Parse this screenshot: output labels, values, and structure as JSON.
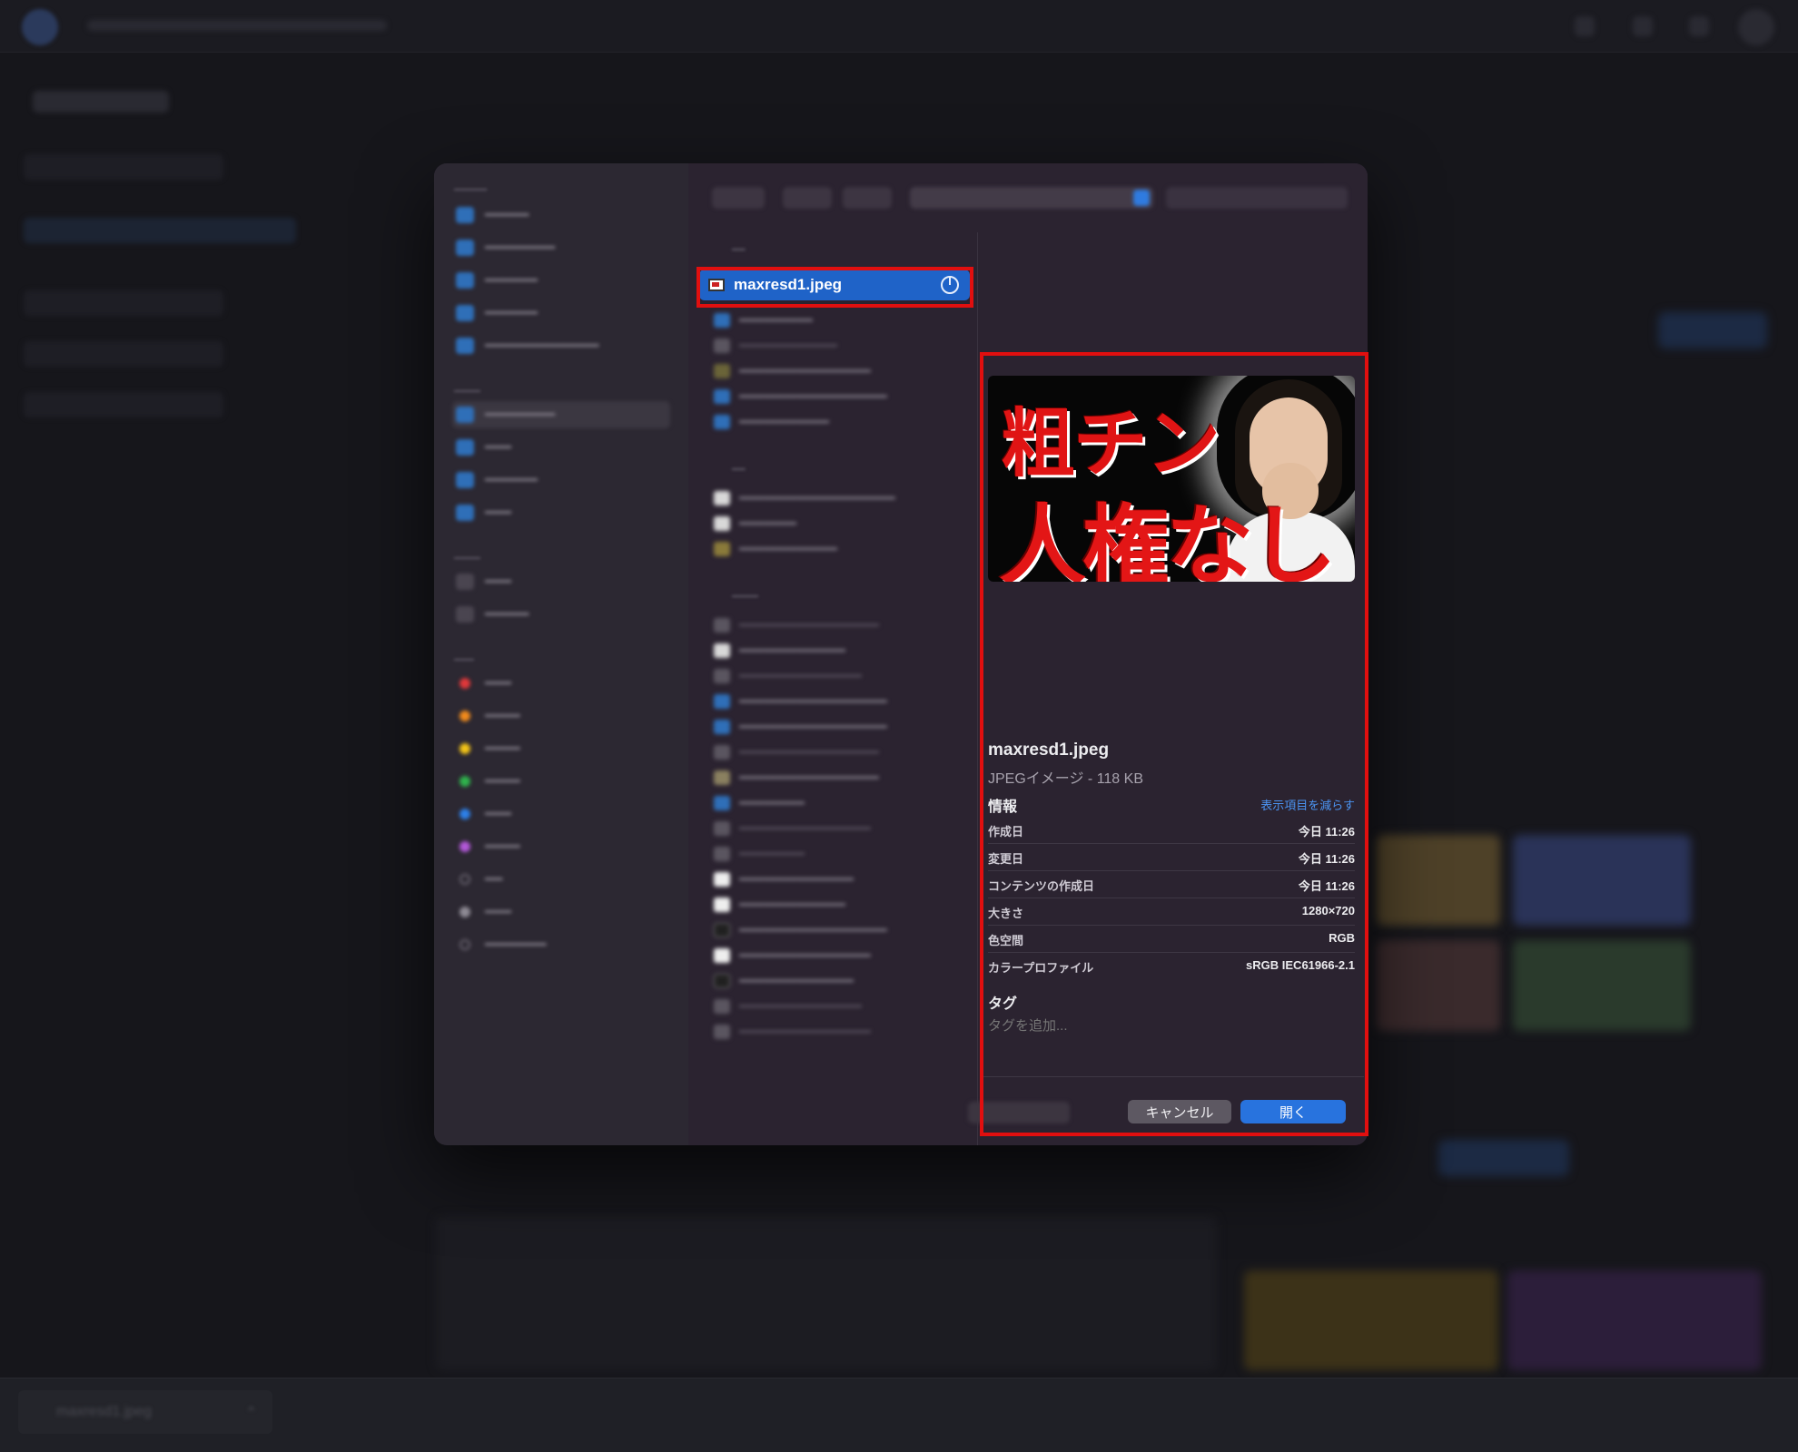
{
  "dialog": {
    "selected_file": {
      "name": "maxresd1.jpeg"
    },
    "preview": {
      "image_text_line1": "粗チン",
      "image_text_line2": "人権なし",
      "file_name": "maxresd1.jpeg",
      "kind": "JPEGイメージ - 118 KB",
      "info_heading": "情報",
      "show_less": "表示項目を減らす",
      "metadata": [
        {
          "label": "作成日",
          "value": "今日 11:26"
        },
        {
          "label": "変更日",
          "value": "今日 11:26"
        },
        {
          "label": "コンテンツの作成日",
          "value": "今日 11:26"
        },
        {
          "label": "大きさ",
          "value": "1280×720"
        },
        {
          "label": "色空間",
          "value": "RGB"
        },
        {
          "label": "カラープロファイル",
          "value": "sRGB IEC61966-2.1"
        }
      ],
      "tags_heading": "タグ",
      "tags_placeholder": "タグを追加..."
    },
    "buttons": {
      "cancel": "キャンセル",
      "open": "開く"
    }
  },
  "colors": {
    "accent_blue": "#2873de",
    "highlight_red": "#e10f0f",
    "dialog_bg": "#2b2330"
  }
}
